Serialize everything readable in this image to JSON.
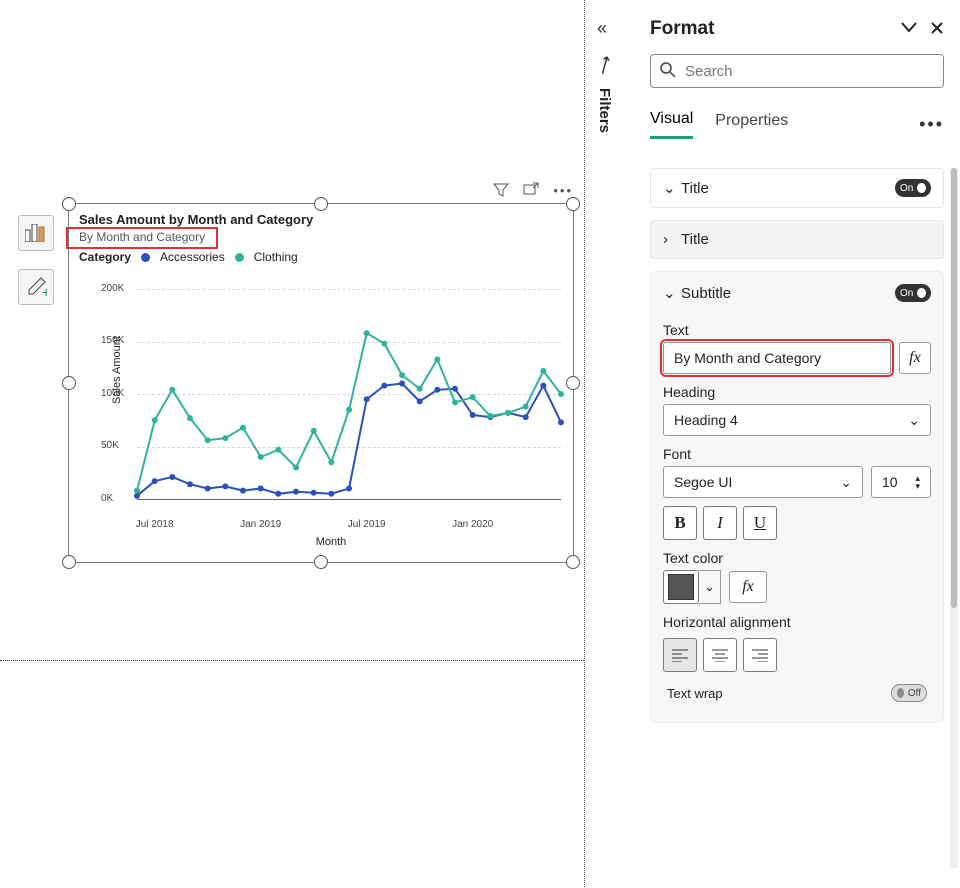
{
  "format_pane": {
    "title": "Format",
    "search_placeholder": "Search",
    "tabs": {
      "visual": "Visual",
      "properties": "Properties"
    },
    "sections": {
      "title_header": "Title",
      "title_sub": "Title",
      "subtitle_header": "Subtitle",
      "text_label": "Text",
      "text_value": "By Month and Category",
      "heading_label": "Heading",
      "heading_value": "Heading 4",
      "font_label": "Font",
      "font_family": "Segoe UI",
      "font_size": "10",
      "text_color_label": "Text color",
      "halign_label": "Horizontal alignment",
      "text_wrap_label": "Text wrap",
      "on": "On",
      "off": "Off"
    }
  },
  "filters_label": "Filters",
  "chart": {
    "title": "Sales Amount by Month and Category",
    "subtitle": "By Month and Category",
    "legend_title": "Category",
    "series_names": {
      "accessories": "Accessories",
      "clothing": "Clothing"
    },
    "ylabel": "Sales Amount",
    "xlabel": "Month",
    "yticks": [
      "0K",
      "50K",
      "100K",
      "150K",
      "200K"
    ],
    "xticks": [
      "Jul 2018",
      "Jan 2019",
      "Jul 2019",
      "Jan 2020"
    ]
  },
  "chart_data": {
    "type": "line",
    "title": "Sales Amount by Month and Category",
    "subtitle": "By Month and Category",
    "xlabel": "Month",
    "ylabel": "Sales Amount",
    "ylim": [
      0,
      200000
    ],
    "x": [
      "Jun 2018",
      "Jul 2018",
      "Aug 2018",
      "Sep 2018",
      "Oct 2018",
      "Nov 2018",
      "Dec 2018",
      "Jan 2019",
      "Feb 2019",
      "Mar 2019",
      "Apr 2019",
      "May 2019",
      "Jun 2019",
      "Jul 2019",
      "Aug 2019",
      "Sep 2019",
      "Oct 2019",
      "Nov 2019",
      "Dec 2019",
      "Jan 2020",
      "Feb 2020",
      "Mar 2020",
      "Apr 2020",
      "May 2020",
      "Jun 2020"
    ],
    "series": [
      {
        "name": "Accessories",
        "color": "#2b50b8",
        "values": [
          3000,
          17000,
          21000,
          14000,
          10000,
          12000,
          8000,
          10000,
          5000,
          7000,
          6000,
          5000,
          10000,
          95000,
          108000,
          110000,
          93000,
          104000,
          105000,
          80000,
          78000,
          82000,
          78000,
          108000,
          73000
        ]
      },
      {
        "name": "Clothing",
        "color": "#2fb39a",
        "values": [
          8000,
          75000,
          104000,
          77000,
          56000,
          58000,
          68000,
          40000,
          47000,
          30000,
          65000,
          35000,
          85000,
          158000,
          148000,
          118000,
          105000,
          133000,
          92000,
          97000,
          79000,
          82000,
          88000,
          122000,
          100000
        ]
      }
    ],
    "xtick_labels": [
      "Jul 2018",
      "Jan 2019",
      "Jul 2019",
      "Jan 2020"
    ]
  }
}
